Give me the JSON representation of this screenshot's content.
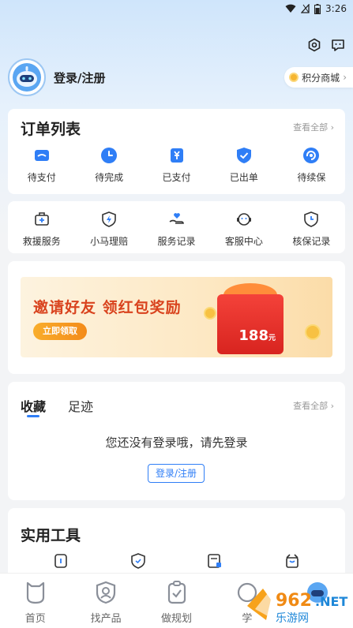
{
  "status_bar": {
    "time": "3:26"
  },
  "profile": {
    "login_label": "登录/注册"
  },
  "points_mall": {
    "label": "积分商城"
  },
  "orders": {
    "title": "订单列表",
    "see_all": "查看全部",
    "items": [
      {
        "label": "待支付",
        "icon": "wallet-icon"
      },
      {
        "label": "待完成",
        "icon": "clock-icon"
      },
      {
        "label": "已支付",
        "icon": "yen-doc-icon"
      },
      {
        "label": "已出单",
        "icon": "shield-check-icon"
      },
      {
        "label": "待续保",
        "icon": "renew-icon"
      }
    ]
  },
  "services": {
    "items": [
      {
        "label": "救援服务",
        "icon": "rescue-kit-icon"
      },
      {
        "label": "小马理赔",
        "icon": "bolt-shield-icon"
      },
      {
        "label": "服务记录",
        "icon": "hand-heart-icon"
      },
      {
        "label": "客服中心",
        "icon": "service-face-icon"
      },
      {
        "label": "核保记录",
        "icon": "clock-shield-icon"
      }
    ]
  },
  "banner": {
    "headline": "邀请好友 领红包奖励",
    "button": "立即领取",
    "amount": "188",
    "amount_unit": "元"
  },
  "favorites": {
    "tab_active": "收藏",
    "tab_other": "足迹",
    "see_all": "查看全部",
    "empty_text": "您还没有登录哦，请先登录",
    "login_button": "登录/注册"
  },
  "tools": {
    "title": "实用工具"
  },
  "tabbar": {
    "items": [
      {
        "label": "首页"
      },
      {
        "label": "找产品"
      },
      {
        "label": "做规划"
      },
      {
        "label": "学"
      },
      {
        "label": ""
      }
    ]
  },
  "watermark": {
    "text": "962.net 乐游网"
  },
  "colors": {
    "accent": "#2f7ef6",
    "banner_red": "#d9431e"
  }
}
